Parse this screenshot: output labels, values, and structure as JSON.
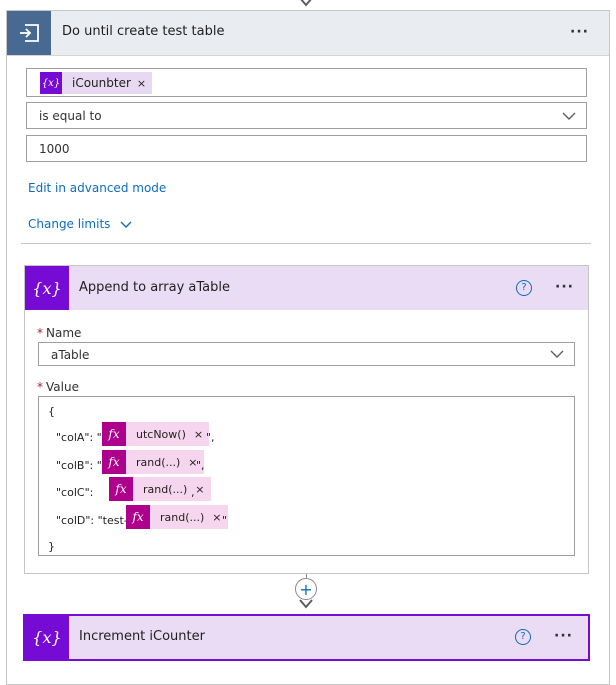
{
  "until": {
    "title": "Do until create test table",
    "menu": "···",
    "condition_token": "iCounbter",
    "token_remove": "×",
    "operator": "is equal to",
    "value": "1000",
    "advanced_link": "Edit in advanced mode",
    "limits_link": "Change limits"
  },
  "append": {
    "title": "Append to array aTable",
    "help": "?",
    "menu": "···",
    "name_label": "Name",
    "name_value": "aTable",
    "value_label": "Value",
    "required_mark": "*",
    "open_brace": "{",
    "close_brace": "}",
    "lines": [
      {
        "prefix": "\"colA\": \"",
        "fn": "utcNow()",
        "suffix": "\","
      },
      {
        "prefix": "\"colB\": \"",
        "fn": "rand(...)",
        "suffix": "\","
      },
      {
        "prefix": "\"colC\":",
        "fn": "rand(...)",
        "suffix": ","
      },
      {
        "prefix": "\"colD\": \"test-",
        "fn": "rand(...)",
        "suffix": "\""
      }
    ],
    "fx_glyph": "fx",
    "remove": "×"
  },
  "increment": {
    "title": "Increment iCounter",
    "help": "?",
    "menu": "···"
  },
  "connector_plus": "+",
  "variable_icon": "{x}",
  "colors": {
    "until_header_bg": "#e9ecf1",
    "until_icon_bg": "#486991",
    "variable_header_bg": "#eadcf5",
    "variable_icon_bg": "#770bd6",
    "fx_bg": "#ad008c",
    "fx_token_bg": "#f6d6ee",
    "link": "#0f6cbd",
    "selected_border": "#770bd6"
  }
}
